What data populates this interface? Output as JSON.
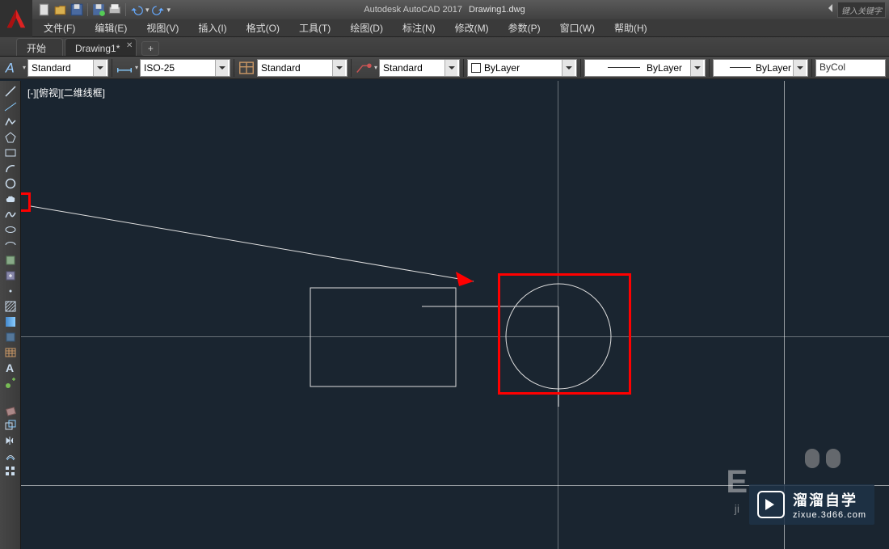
{
  "title": {
    "app": "Autodesk AutoCAD 2017",
    "doc": "Drawing1.dwg"
  },
  "search_placeholder": "键入关键字",
  "menus": [
    "文件(F)",
    "编辑(E)",
    "视图(V)",
    "插入(I)",
    "格式(O)",
    "工具(T)",
    "绘图(D)",
    "标注(N)",
    "修改(M)",
    "参数(P)",
    "窗口(W)",
    "帮助(H)"
  ],
  "tabs": {
    "start": "开始",
    "doc": "Drawing1*",
    "add": "+"
  },
  "ribbon": {
    "textstyle": "Standard",
    "dimstyle": "ISO-25",
    "tablestyle": "Standard",
    "mleaderstyle": "Standard",
    "layer": "ByLayer",
    "linetype": "ByLayer",
    "lineweight": "ByLayer",
    "color": "ByCol"
  },
  "viewport_label": "[-][俯视][二维线框]",
  "watermark": {
    "cn": "溜溜自学",
    "url": "zixue.3d66.com"
  },
  "chart_data": null
}
